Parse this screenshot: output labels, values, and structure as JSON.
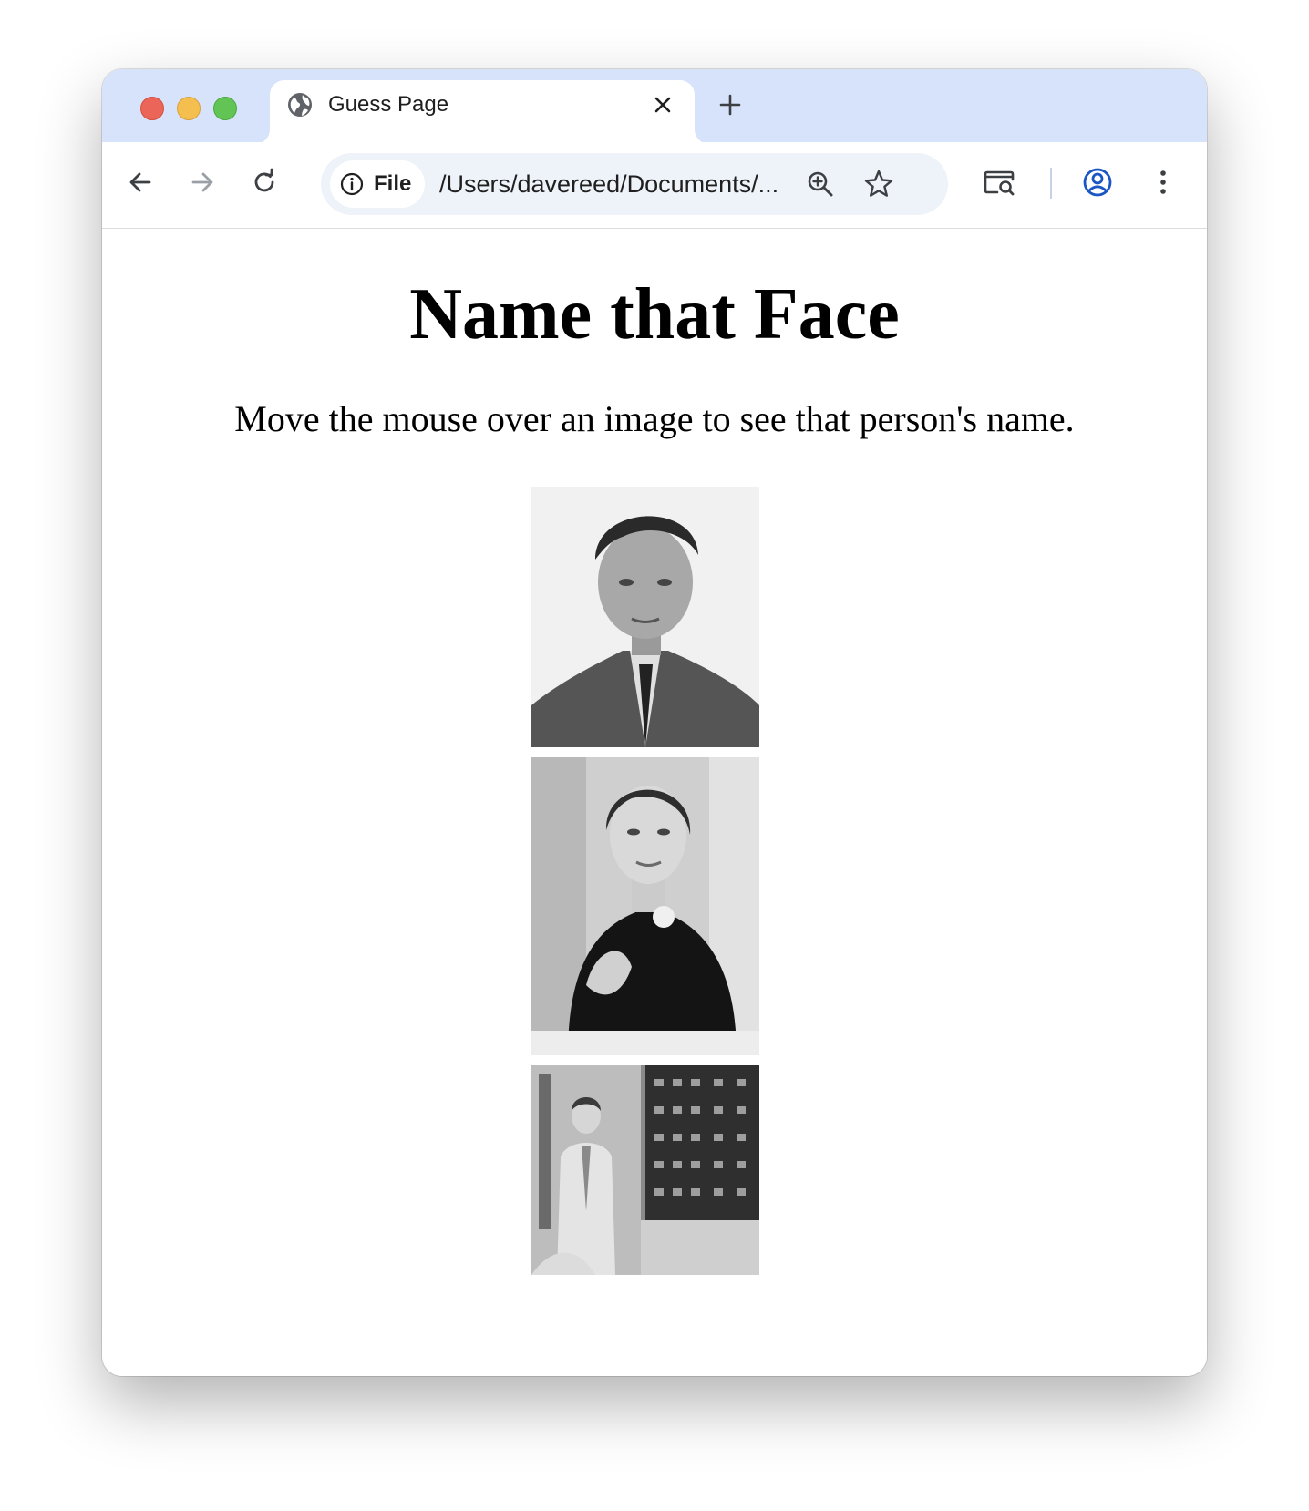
{
  "tab": {
    "title": "Guess Page",
    "icon": "globe-icon"
  },
  "toolbar": {
    "site_info_label": "File",
    "url": "/Users/davereed/Documents/...",
    "icons": [
      "back-arrow-icon",
      "forward-arrow-icon",
      "reload-icon",
      "info-icon",
      "zoom-icon",
      "bookmark-star-icon",
      "search-tab-icon",
      "profile-icon",
      "more-vertical-icon"
    ]
  },
  "page": {
    "heading": "Name that Face",
    "instructions": "Move the mouse over an image to see that person's name."
  },
  "colors": {
    "tabstrip": "#d7e3fb",
    "omnibox": "#eef2f9",
    "profile_accent": "#1a56c4"
  }
}
